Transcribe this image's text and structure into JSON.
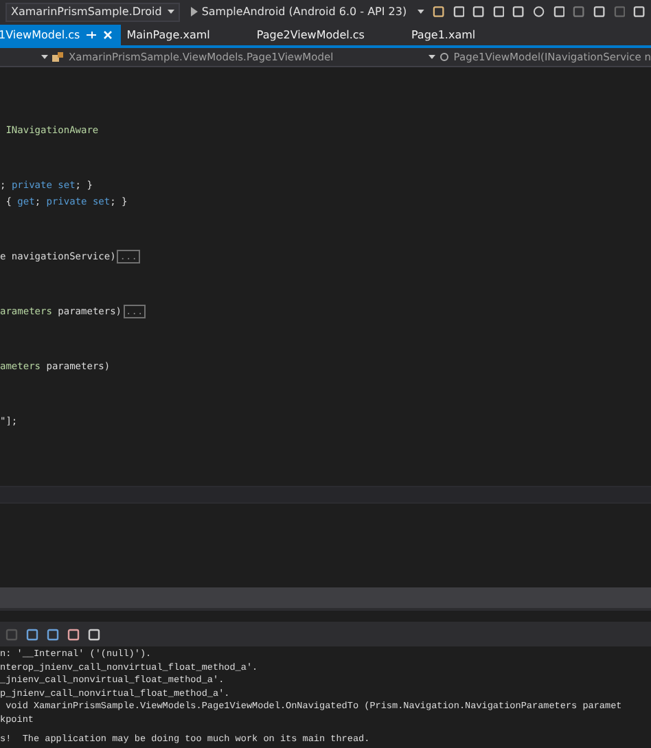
{
  "toolbar": {
    "project": "XamarinPrismSample.Droid",
    "target": "SampleAndroid (Android 6.0 - API 23)"
  },
  "tabs": [
    {
      "label": "1ViewModel.cs",
      "selected": true
    },
    {
      "label": "MainPage.xaml",
      "selected": false
    },
    {
      "label": "Page2ViewModel.cs",
      "selected": false
    },
    {
      "label": "Page1.xaml",
      "selected": false
    }
  ],
  "navbar": {
    "type": "XamarinPrismSample.ViewModels.Page1ViewModel",
    "member": "Page1ViewModel(INavigationService n"
  },
  "code_blocks": [
    [
      [
        {
          "kind": "type",
          "text": " INavigationAware"
        }
      ]
    ],
    [
      [
        {
          "kind": "plain",
          "text": "; "
        },
        {
          "kind": "keyword",
          "text": "private set"
        },
        {
          "kind": "plain",
          "text": "; }"
        }
      ],
      [
        {
          "kind": "plain",
          "text": " { "
        },
        {
          "kind": "keyword",
          "text": "get"
        },
        {
          "kind": "plain",
          "text": "; "
        },
        {
          "kind": "keyword",
          "text": "private set"
        },
        {
          "kind": "plain",
          "text": "; }"
        }
      ]
    ],
    [
      [
        {
          "kind": "plain",
          "text": "e navigationService)"
        },
        {
          "kind": "collapsed",
          "text": "..."
        }
      ]
    ],
    [
      [
        {
          "kind": "type",
          "text": "arameters"
        },
        {
          "kind": "plain",
          "text": " parameters)"
        },
        {
          "kind": "collapsed",
          "text": "..."
        }
      ]
    ],
    [
      [
        {
          "kind": "type",
          "text": "ameters"
        },
        {
          "kind": "plain",
          "text": " parameters)"
        }
      ]
    ],
    [
      [
        {
          "kind": "plain",
          "text": "\"];"
        }
      ]
    ]
  ],
  "output_lines": [
    "n: '__Internal' ('(null)').",
    "nterop_jnienv_call_nonvirtual_float_method_a'.",
    "_jnienv_call_nonvirtual_float_method_a'.",
    "p_jnienv_call_nonvirtual_float_method_a'.",
    " void XamarinPrismSample.ViewModels.Page1ViewModel.OnNavigatedTo (Prism.Navigation.NavigationParameters paramet",
    "kpoint",
    "s!  The application may be doing too much work on its main thread."
  ]
}
